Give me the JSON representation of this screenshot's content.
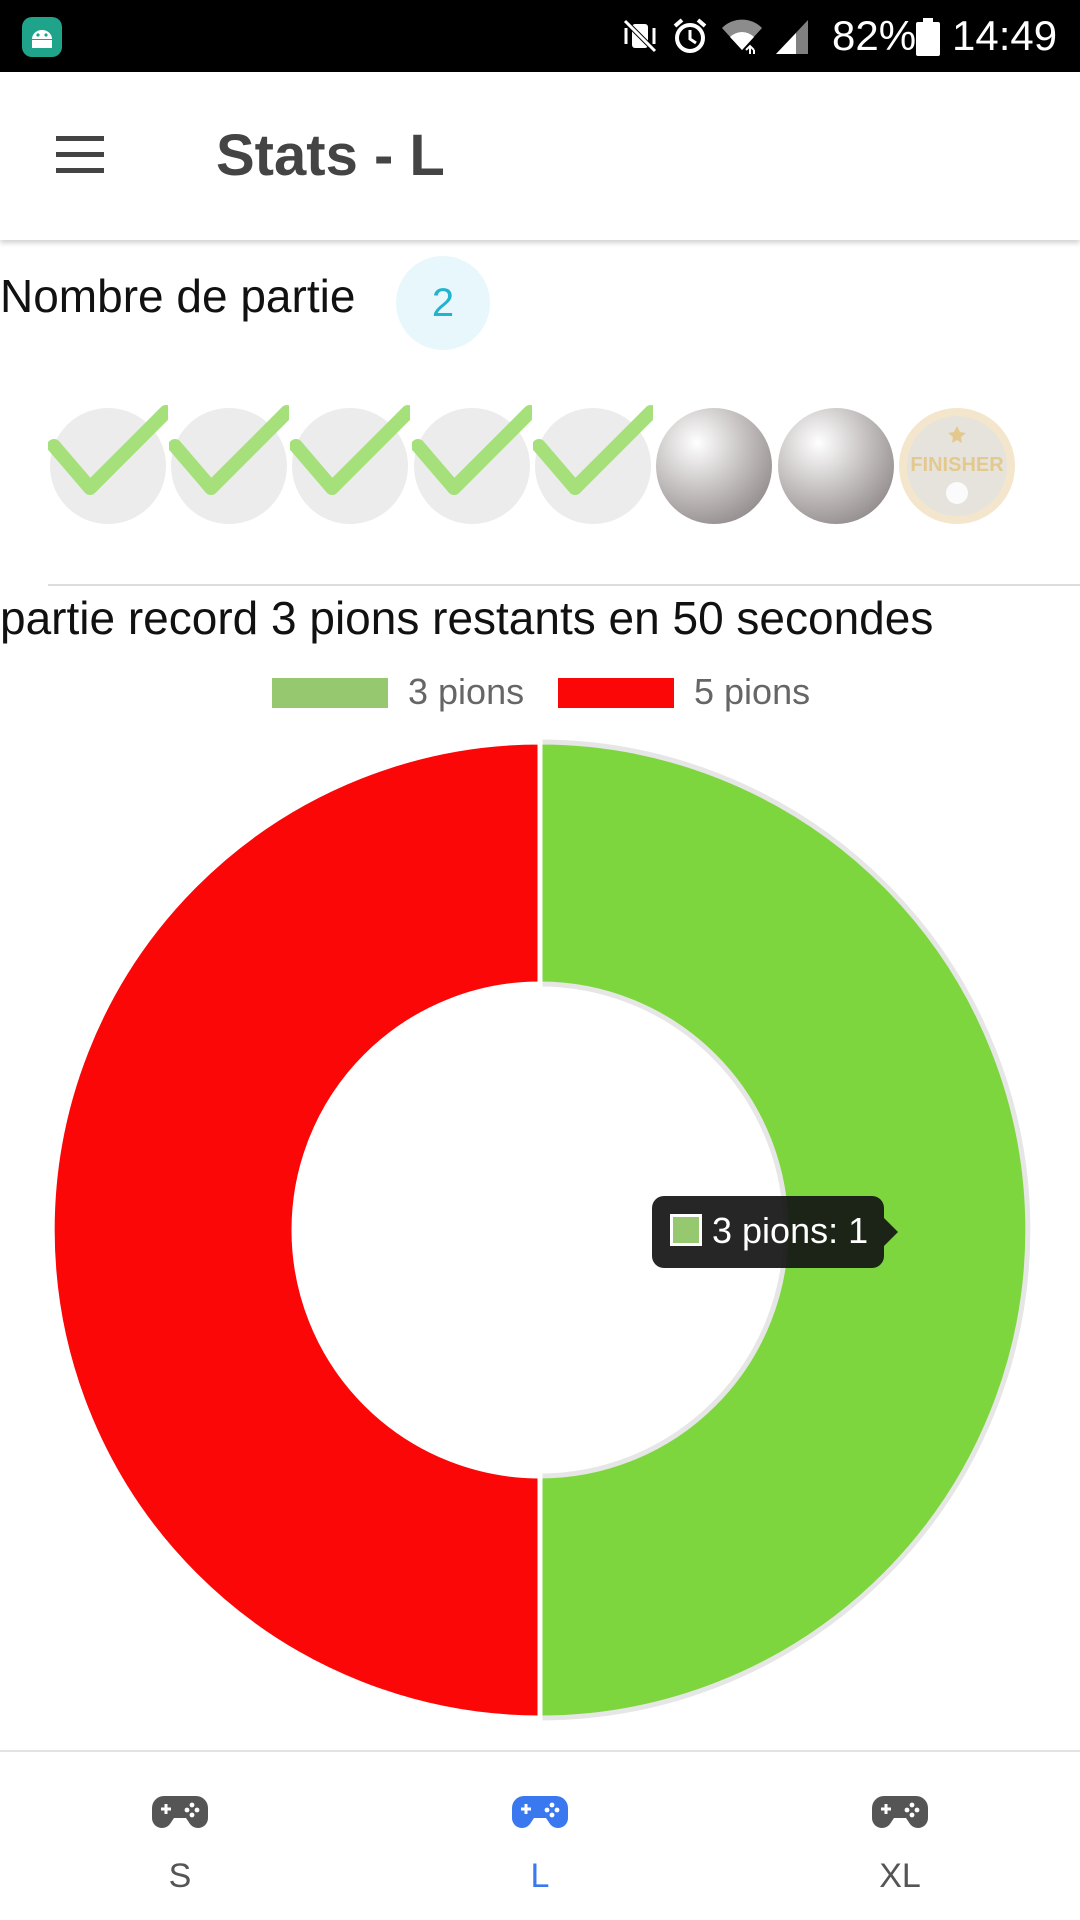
{
  "status_bar": {
    "battery_percent": "82%",
    "time": "14:49",
    "icons": [
      "android-app-icon",
      "mute-vibrate-icon",
      "alarm-icon",
      "wifi-icon",
      "cell-signal-icon",
      "battery-icon"
    ]
  },
  "app_bar": {
    "title": "Stats - L",
    "menu_icon": "hamburger-menu-icon"
  },
  "games": {
    "label": "Nombre de partie",
    "count": "2"
  },
  "progress": {
    "completed": 5,
    "total": 7,
    "finisher_label": "FINISHER",
    "colors": {
      "check": "#a6e07a",
      "done_bg": "#ececec",
      "pending": "#b3aeae",
      "finisher": "#e8d3a6"
    }
  },
  "record": {
    "text": "partie record 3 pions restants en 50 secondes"
  },
  "chart_data": {
    "type": "pie",
    "donut": true,
    "series": [
      {
        "name": "3 pions",
        "value": 1,
        "color": "#7ed63f",
        "legend_color": "#96c86f"
      },
      {
        "name": "5 pions",
        "value": 1,
        "color": "#fb0707",
        "legend_color": "#fb0707"
      }
    ],
    "legend": {
      "position": "top"
    },
    "tooltip": {
      "text": "3 pions: 1"
    }
  },
  "bottom_nav": {
    "items": [
      {
        "label": "S",
        "active": false,
        "icon": "gamepad-icon"
      },
      {
        "label": "L",
        "active": true,
        "icon": "gamepad-icon"
      },
      {
        "label": "XL",
        "active": false,
        "icon": "gamepad-icon"
      }
    ],
    "colors": {
      "active": "#3a78f0",
      "inactive": "#555555"
    }
  }
}
